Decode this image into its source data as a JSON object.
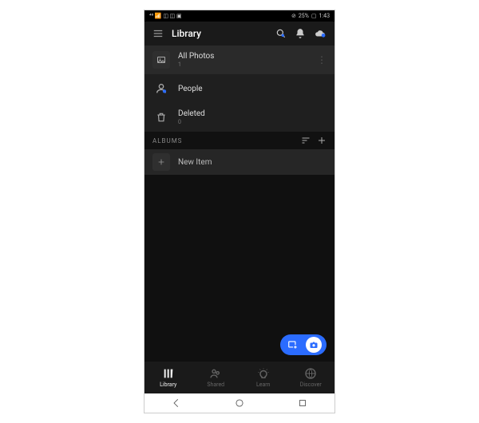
{
  "status": {
    "left": "⁴⁶ 📶 ◫ ◫ ▣",
    "right_icons": "⊘",
    "battery": "25%",
    "batt_icon": "▢",
    "time": "1:43"
  },
  "header": {
    "title": "Library"
  },
  "rows": {
    "allphotos": {
      "label": "All Photos",
      "count": "1"
    },
    "people": {
      "label": "People"
    },
    "deleted": {
      "label": "Deleted",
      "count": "0"
    }
  },
  "section": {
    "label": "ALBUMS"
  },
  "albums": {
    "newitem": {
      "label": "New Item"
    }
  },
  "nav": {
    "library": "Library",
    "shared": "Shared",
    "learn": "Learn",
    "discover": "Discover"
  }
}
